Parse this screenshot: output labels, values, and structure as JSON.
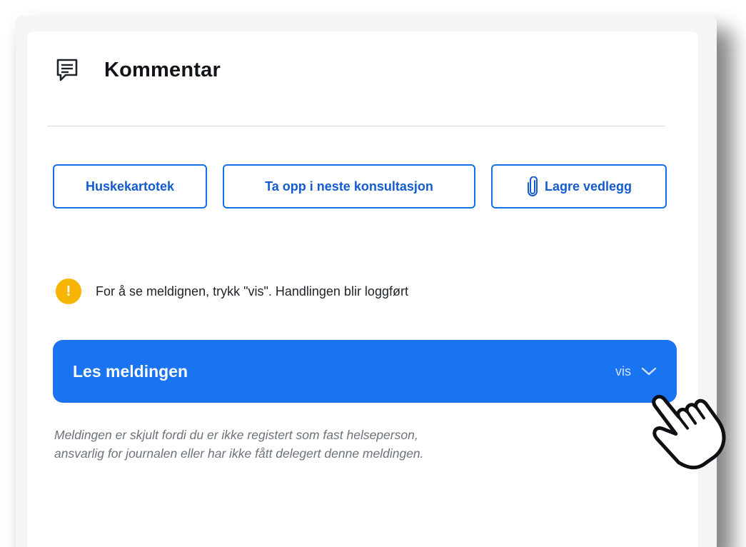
{
  "header": {
    "title": "Kommentar",
    "icon": "comment-icon"
  },
  "actions": [
    {
      "label": "Huskekartotek"
    },
    {
      "label": "Ta opp i neste konsultasjon"
    },
    {
      "label": "Lagre vedlegg",
      "icon": "paperclip-icon"
    }
  ],
  "notice": {
    "icon": "warning-icon",
    "icon_glyph": "!",
    "text": "For å se meldignen, trykk \"vis\". Handlingen blir loggført"
  },
  "accordion": {
    "title": "Les meldingen",
    "toggle_label": "vis",
    "toggle_icon": "chevron-down-icon"
  },
  "hidden_note": {
    "line1": "Meldingen er skjult fordi du er ikke registert som fast helseperson,",
    "line2": "ansvarlig for journalen eller har ikke fått delegert denne meldingen."
  },
  "colors": {
    "primary": "#1a73f0",
    "button_border": "#1570e8",
    "warning": "#f7b500"
  }
}
